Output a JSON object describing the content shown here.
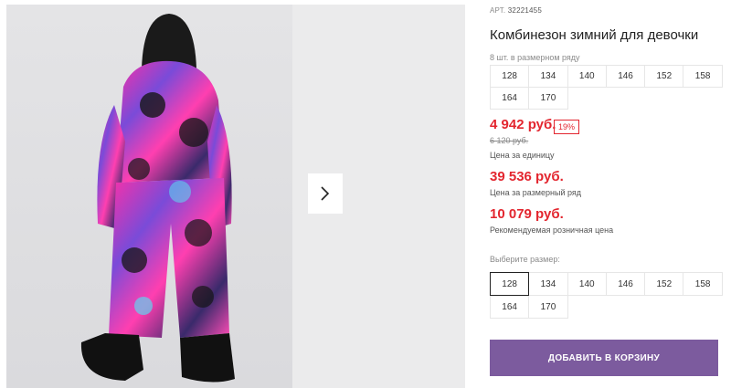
{
  "product": {
    "article_label": "АРТ.",
    "article_value": "32221455",
    "title": "Комбинезон зимний для девочки",
    "row_note": "8 шт. в размерном ряду",
    "row_sizes": [
      "128",
      "134",
      "140",
      "146",
      "152",
      "158",
      "164",
      "170"
    ]
  },
  "pricing": {
    "unit_price": "4 942 руб.",
    "discount": "19%",
    "old_price": "6 120 руб.",
    "unit_label": "Цена за единицу",
    "row_price": "39 536 руб.",
    "row_label": "Цена за размерный ряд",
    "rrp_price": "10 079 руб.",
    "rrp_label": "Рекомендуемая розничная цена"
  },
  "size_selector": {
    "label": "Выберите размер:",
    "selected": "128",
    "sizes": [
      "128",
      "134",
      "140",
      "146",
      "152",
      "158",
      "164",
      "170"
    ]
  },
  "cart": {
    "button_label": "ДОБАВИТЬ В КОРЗИНУ"
  },
  "gallery": {
    "next_icon": "chevron-right-icon"
  },
  "colors": {
    "price_red": "#e3262f",
    "button_purple": "#7c5b9e",
    "selected_border": "#222222"
  }
}
